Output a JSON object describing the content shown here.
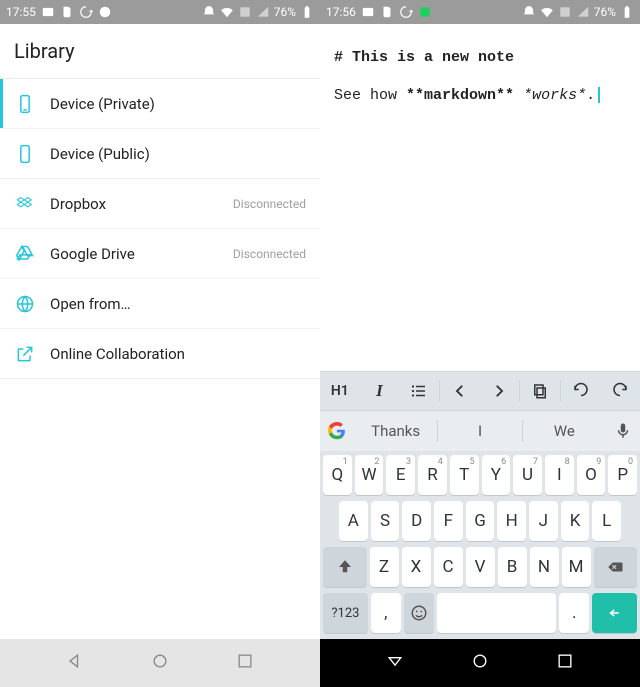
{
  "left": {
    "status": {
      "time": "17:55",
      "battery": "76%"
    },
    "header": "Library",
    "items": [
      {
        "label": "Device (Private)",
        "status": "",
        "active": true,
        "icon": "phone"
      },
      {
        "label": "Device (Public)",
        "status": "",
        "active": false,
        "icon": "phone-outline"
      },
      {
        "label": "Dropbox",
        "status": "Disconnected",
        "active": false,
        "icon": "dropbox"
      },
      {
        "label": "Google Drive",
        "status": "Disconnected",
        "active": false,
        "icon": "gdrive"
      },
      {
        "label": "Open from…",
        "status": "",
        "active": false,
        "icon": "globe"
      },
      {
        "label": "Online Collaboration",
        "status": "",
        "active": false,
        "icon": "external"
      }
    ]
  },
  "right": {
    "status": {
      "time": "17:56",
      "battery": "76%"
    },
    "note": {
      "h_prefix": "# ",
      "h_text": "This is a new note",
      "p_pre": "See how ",
      "p_bold": "**markdown**",
      "p_mid": " ",
      "p_ital": "*works*",
      "p_post": "."
    },
    "toolbar": {
      "h1": "H1"
    },
    "suggestions": [
      "Thanks",
      "I",
      "We"
    ],
    "keyboard": {
      "row1": [
        {
          "k": "Q",
          "s": "1"
        },
        {
          "k": "W",
          "s": "2"
        },
        {
          "k": "E",
          "s": "3"
        },
        {
          "k": "R",
          "s": "4"
        },
        {
          "k": "T",
          "s": "5"
        },
        {
          "k": "Y",
          "s": "6"
        },
        {
          "k": "U",
          "s": "7"
        },
        {
          "k": "I",
          "s": "8"
        },
        {
          "k": "O",
          "s": "9"
        },
        {
          "k": "P",
          "s": "0"
        }
      ],
      "row2": [
        "A",
        "S",
        "D",
        "F",
        "G",
        "H",
        "J",
        "K",
        "L"
      ],
      "row3": [
        "Z",
        "X",
        "C",
        "V",
        "B",
        "N",
        "M"
      ],
      "row4": {
        "sym": "?123",
        "comma": ",",
        "period": "."
      }
    }
  }
}
